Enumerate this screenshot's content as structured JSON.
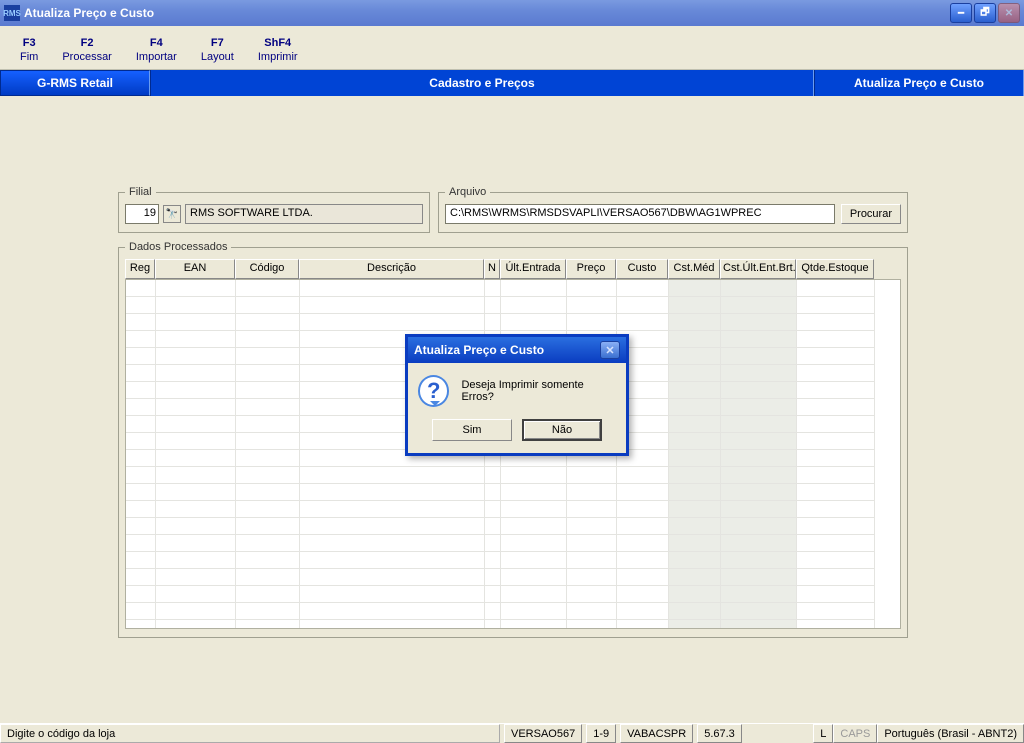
{
  "window": {
    "icon_text": "RMS",
    "title": "Atualiza Preço e Custo"
  },
  "fkeys": [
    {
      "key": "F3",
      "label": "Fim"
    },
    {
      "key": "F2",
      "label": "Processar"
    },
    {
      "key": "F4",
      "label": "Importar"
    },
    {
      "key": "F7",
      "label": "Layout"
    },
    {
      "key": "ShF4",
      "label": "Imprimir"
    }
  ],
  "nav": {
    "left": "G-RMS Retail",
    "center": "Cadastro e Preços",
    "right": "Atualiza Preço e Custo"
  },
  "filial": {
    "legend": "Filial",
    "code": "19",
    "name": "RMS SOFTWARE LTDA."
  },
  "arquivo": {
    "legend": "Arquivo",
    "path": "C:\\RMS\\WRMS\\RMSDSVAPLI\\VERSAO567\\DBW\\AG1WPREC",
    "procurar": "Procurar"
  },
  "grid": {
    "legend": "Dados Processados",
    "headers": {
      "reg": "Reg",
      "ean": "EAN",
      "cod": "Código",
      "desc": "Descrição",
      "n": "N",
      "ult": "Últ.Entrada",
      "preco": "Preço",
      "custo": "Custo",
      "cstmed": "Cst.Méd",
      "cstult": "Cst.Últ.Ent.Brt.",
      "qtde": "Qtde.Estoque"
    }
  },
  "dialog": {
    "title": "Atualiza Preço e Custo",
    "message": "Deseja Imprimir somente Erros?",
    "yes": "Sim",
    "no": "Não"
  },
  "status": {
    "hint": "Digite o código da loja",
    "version": "VERSAO567",
    "pages": "1-9",
    "program": "VABACSPR",
    "build": "5.67.3",
    "flag": "L",
    "caps": "CAPS",
    "kbd": "Português (Brasil - ABNT2)"
  }
}
